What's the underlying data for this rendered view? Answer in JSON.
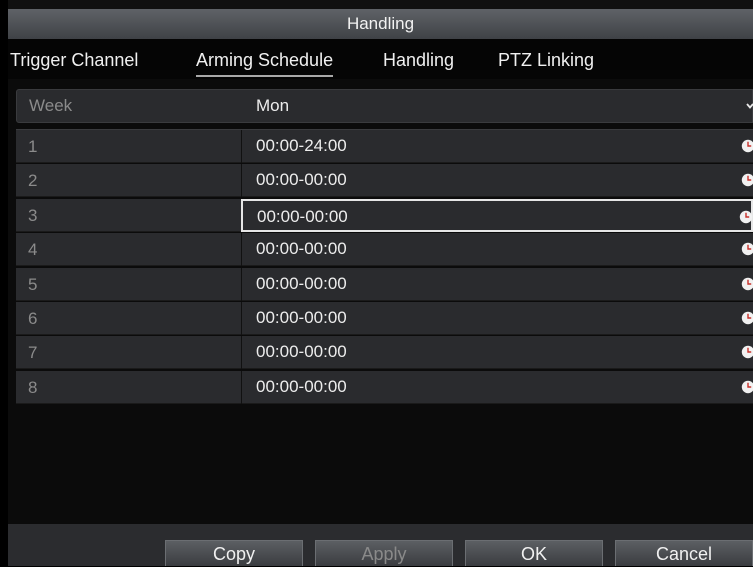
{
  "window": {
    "title": "Handling"
  },
  "tabs": [
    {
      "label": "Trigger Channel",
      "active": false
    },
    {
      "label": "Arming Schedule",
      "active": true
    },
    {
      "label": "Handling",
      "active": false
    },
    {
      "label": "PTZ Linking",
      "active": false
    }
  ],
  "week": {
    "label": "Week",
    "value": "Mon"
  },
  "schedule": [
    {
      "index": "1",
      "time": "00:00-24:00"
    },
    {
      "index": "2",
      "time": "00:00-00:00"
    },
    {
      "index": "3",
      "time": "00:00-00:00",
      "selected": true
    },
    {
      "index": "4",
      "time": "00:00-00:00"
    },
    {
      "index": "5",
      "time": "00:00-00:00"
    },
    {
      "index": "6",
      "time": "00:00-00:00"
    },
    {
      "index": "7",
      "time": "00:00-00:00"
    },
    {
      "index": "8",
      "time": "00:00-00:00"
    }
  ],
  "buttons": {
    "copy": "Copy",
    "apply": "Apply",
    "ok": "OK",
    "cancel": "Cancel"
  },
  "icons": {
    "schedule_time": "clock-icon",
    "week_dropdown": "chevron-down-icon"
  },
  "colors": {
    "title_bar": "#4f5257",
    "row_background": "#2a2b2e",
    "clock_hand": "#c8302a"
  }
}
